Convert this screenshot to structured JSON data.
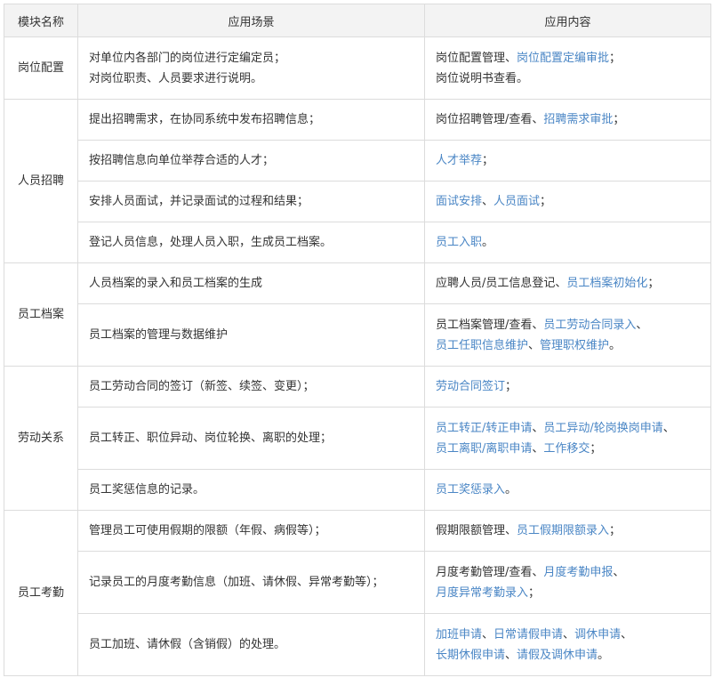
{
  "headers": [
    "模块名称",
    "应用场景",
    "应用内容"
  ],
  "modules": [
    {
      "name": "岗位配置",
      "rows": [
        {
          "scene": [
            "对单位内各部门的岗位进行定编定员；",
            "对岗位职责、人员要求进行说明。"
          ],
          "content": [
            [
              {
                "t": "岗位配置管理、",
                "l": false
              },
              {
                "t": "岗位配置定编审批",
                "l": true
              },
              {
                "t": "；",
                "l": false
              }
            ],
            [
              {
                "t": "岗位说明书查看。",
                "l": false
              }
            ]
          ]
        }
      ]
    },
    {
      "name": "人员招聘",
      "rows": [
        {
          "scene": [
            "提出招聘需求，在协同系统中发布招聘信息；"
          ],
          "content": [
            [
              {
                "t": "岗位招聘管理/查看、",
                "l": false
              },
              {
                "t": "招聘需求审批",
                "l": true
              },
              {
                "t": "；",
                "l": false
              }
            ]
          ]
        },
        {
          "scene": [
            "按招聘信息向单位举荐合适的人才；"
          ],
          "content": [
            [
              {
                "t": "人才举荐",
                "l": true
              },
              {
                "t": "；",
                "l": false
              }
            ]
          ]
        },
        {
          "scene": [
            "安排人员面试，并记录面试的过程和结果；"
          ],
          "content": [
            [
              {
                "t": "面试安排",
                "l": true
              },
              {
                "t": "、",
                "l": false
              },
              {
                "t": "人员面试",
                "l": true
              },
              {
                "t": "；",
                "l": false
              }
            ]
          ]
        },
        {
          "scene": [
            "登记人员信息，处理人员入职，生成员工档案。"
          ],
          "content": [
            [
              {
                "t": "员工入职",
                "l": true
              },
              {
                "t": "。",
                "l": false
              }
            ]
          ]
        }
      ]
    },
    {
      "name": "员工档案",
      "rows": [
        {
          "scene": [
            "人员档案的录入和员工档案的生成"
          ],
          "content": [
            [
              {
                "t": "应聘人员/员工信息登记、",
                "l": false
              },
              {
                "t": "员工档案初始化",
                "l": true
              },
              {
                "t": "；",
                "l": false
              }
            ]
          ]
        },
        {
          "scene": [
            "员工档案的管理与数据维护"
          ],
          "content": [
            [
              {
                "t": "员工档案管理/查看、",
                "l": false
              },
              {
                "t": "员工劳动合同录入",
                "l": true
              },
              {
                "t": "、",
                "l": false
              }
            ],
            [
              {
                "t": "员工任职信息维护",
                "l": true
              },
              {
                "t": "、",
                "l": false
              },
              {
                "t": "管理职权维护",
                "l": true
              },
              {
                "t": "。",
                "l": false
              }
            ]
          ]
        }
      ]
    },
    {
      "name": "劳动关系",
      "rows": [
        {
          "scene": [
            "员工劳动合同的签订（新签、续签、变更）；"
          ],
          "content": [
            [
              {
                "t": "劳动合同签订",
                "l": true
              },
              {
                "t": "；",
                "l": false
              }
            ]
          ]
        },
        {
          "scene": [
            "员工转正、职位异动、岗位轮换、离职的处理；"
          ],
          "content": [
            [
              {
                "t": "员工转正/转正申请",
                "l": true
              },
              {
                "t": "、",
                "l": false
              },
              {
                "t": "员工异动/轮岗换岗申请",
                "l": true
              },
              {
                "t": "、",
                "l": false
              }
            ],
            [
              {
                "t": "员工离职/离职申请",
                "l": true
              },
              {
                "t": "、",
                "l": false
              },
              {
                "t": "工作移交",
                "l": true
              },
              {
                "t": "；",
                "l": false
              }
            ]
          ]
        },
        {
          "scene": [
            "员工奖惩信息的记录。"
          ],
          "content": [
            [
              {
                "t": "员工奖惩录入",
                "l": true
              },
              {
                "t": "。",
                "l": false
              }
            ]
          ]
        }
      ]
    },
    {
      "name": "员工考勤",
      "rows": [
        {
          "scene": [
            "管理员工可使用假期的限额（年假、病假等）；"
          ],
          "content": [
            [
              {
                "t": "假期限额管理、",
                "l": false
              },
              {
                "t": "员工假期限额录入",
                "l": true
              },
              {
                "t": "；",
                "l": false
              }
            ]
          ]
        },
        {
          "scene": [
            "记录员工的月度考勤信息（加班、请休假、异常考勤等）；"
          ],
          "content": [
            [
              {
                "t": "月度考勤管理/查看、",
                "l": false
              },
              {
                "t": "月度考勤申报",
                "l": true
              },
              {
                "t": "、",
                "l": false
              }
            ],
            [
              {
                "t": "月度异常考勤录入",
                "l": true
              },
              {
                "t": "；",
                "l": false
              }
            ]
          ]
        },
        {
          "scene": [
            "员工加班、请休假（含销假）的处理。"
          ],
          "content": [
            [
              {
                "t": "加班申请",
                "l": true
              },
              {
                "t": "、",
                "l": false
              },
              {
                "t": "日常请假申请",
                "l": true
              },
              {
                "t": "、",
                "l": false
              },
              {
                "t": "调休申请",
                "l": true
              },
              {
                "t": "、",
                "l": false
              }
            ],
            [
              {
                "t": "长期休假申请",
                "l": true
              },
              {
                "t": "、",
                "l": false
              },
              {
                "t": "请假及调休申请",
                "l": true
              },
              {
                "t": "。",
                "l": false
              }
            ]
          ]
        }
      ]
    }
  ]
}
